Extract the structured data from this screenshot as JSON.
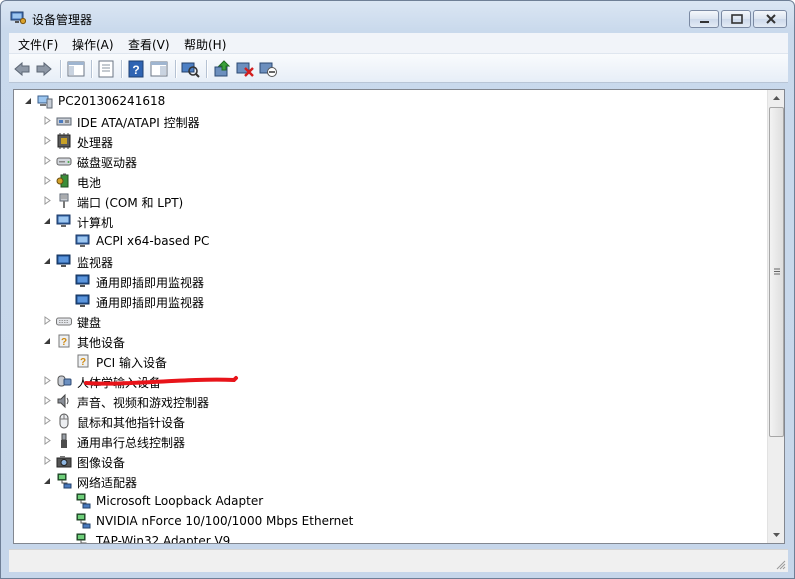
{
  "window": {
    "title": "设备管理器"
  },
  "menu": [
    "文件(F)",
    "操作(A)",
    "查看(V)",
    "帮助(H)"
  ],
  "toolbar_icons": [
    "back-icon",
    "forward-icon",
    "show-hide-console-tree-icon",
    "properties-icon",
    "help-icon",
    "action-pane-icon",
    "scan-hardware-icon",
    "update-driver-icon",
    "uninstall-icon",
    "disable-device-icon"
  ],
  "tree": [
    {
      "label": "PC201306241618",
      "indent": 0,
      "expander": "open",
      "icon": "computer-root-icon"
    },
    {
      "label": "IDE ATA/ATAPI 控制器",
      "indent": 1,
      "expander": "closed",
      "icon": "ide-controller-icon"
    },
    {
      "label": "处理器",
      "indent": 1,
      "expander": "closed",
      "icon": "processor-icon"
    },
    {
      "label": "磁盘驱动器",
      "indent": 1,
      "expander": "closed",
      "icon": "disk-drive-icon"
    },
    {
      "label": "电池",
      "indent": 1,
      "expander": "closed",
      "icon": "battery-icon"
    },
    {
      "label": "端口 (COM 和 LPT)",
      "indent": 1,
      "expander": "closed",
      "icon": "port-icon"
    },
    {
      "label": "计算机",
      "indent": 1,
      "expander": "open",
      "icon": "computer-icon"
    },
    {
      "label": "ACPI x64-based PC",
      "indent": 2,
      "expander": "none",
      "icon": "computer-icon"
    },
    {
      "label": "监视器",
      "indent": 1,
      "expander": "open",
      "icon": "monitor-icon"
    },
    {
      "label": "通用即插即用监视器",
      "indent": 2,
      "expander": "none",
      "icon": "monitor-icon"
    },
    {
      "label": "通用即插即用监视器",
      "indent": 2,
      "expander": "none",
      "icon": "monitor-icon"
    },
    {
      "label": "键盘",
      "indent": 1,
      "expander": "closed",
      "icon": "keyboard-icon"
    },
    {
      "label": "其他设备",
      "indent": 1,
      "expander": "open",
      "icon": "unknown-device-icon"
    },
    {
      "label": "PCI 输入设备",
      "indent": 2,
      "expander": "none",
      "icon": "unknown-device-icon"
    },
    {
      "label": "人体学输入设备",
      "indent": 1,
      "expander": "closed",
      "icon": "hid-icon"
    },
    {
      "label": "声音、视频和游戏控制器",
      "indent": 1,
      "expander": "closed",
      "icon": "sound-icon"
    },
    {
      "label": "鼠标和其他指针设备",
      "indent": 1,
      "expander": "closed",
      "icon": "mouse-icon"
    },
    {
      "label": "通用串行总线控制器",
      "indent": 1,
      "expander": "closed",
      "icon": "usb-icon"
    },
    {
      "label": "图像设备",
      "indent": 1,
      "expander": "closed",
      "icon": "camera-icon"
    },
    {
      "label": "网络适配器",
      "indent": 1,
      "expander": "open",
      "icon": "network-icon"
    },
    {
      "label": "Microsoft Loopback Adapter",
      "indent": 2,
      "expander": "none",
      "icon": "network-icon"
    },
    {
      "label": "NVIDIA nForce 10/100/1000 Mbps Ethernet",
      "indent": 2,
      "expander": "none",
      "icon": "network-icon"
    },
    {
      "label": "TAP-Win32 Adapter V9",
      "indent": 2,
      "expander": "none",
      "icon": "network-icon"
    }
  ],
  "colors": {
    "annotation": "#e8141a",
    "titlebar": "#c9d9ec"
  }
}
